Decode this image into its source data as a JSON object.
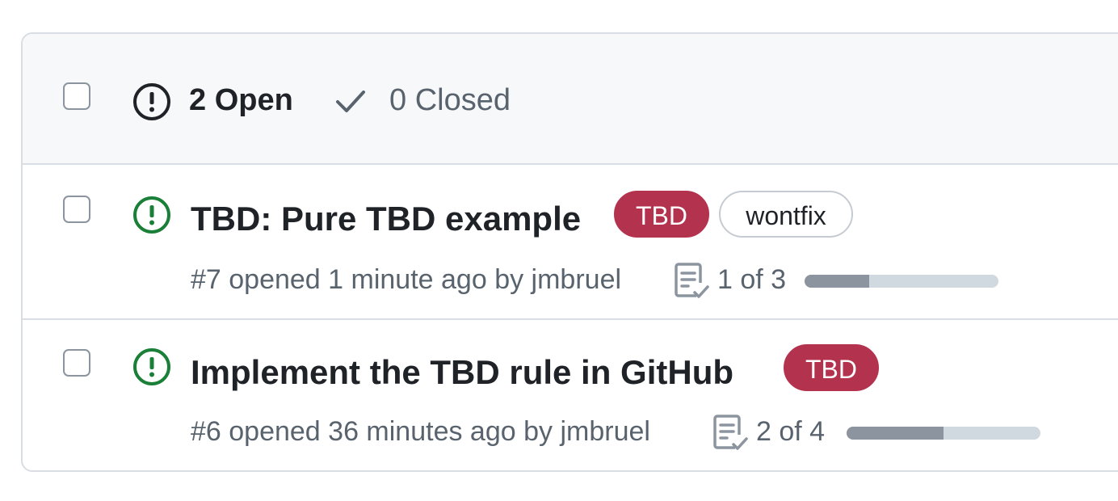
{
  "header": {
    "open_label": "2 Open",
    "closed_label": "0 Closed"
  },
  "issues": [
    {
      "title": "TBD: Pure TBD example",
      "labels": [
        {
          "name": "TBD",
          "bg": "#b3334f",
          "fg": "#ffffff",
          "border": "#b3334f"
        },
        {
          "name": "wontfix",
          "bg": "#ffffff",
          "fg": "#1f2328",
          "border": "#c6cbd1"
        }
      ],
      "meta": "#7 opened 1 minute ago by jmbruel",
      "tasks": "1 of 3",
      "task_progress": 0.333
    },
    {
      "title": "Implement the TBD rule in GitHub",
      "labels": [
        {
          "name": "TBD",
          "bg": "#b3334f",
          "fg": "#ffffff",
          "border": "#b3334f"
        }
      ],
      "meta": "#6 opened 36 minutes ago by jmbruel",
      "tasks": "2 of 4",
      "task_progress": 0.5
    }
  ],
  "colors": {
    "open_icon": "#1a7f37",
    "header_bg": "#f6f8fa",
    "border": "#d8dee4"
  },
  "icons": [
    "issue-opened-icon",
    "check-icon",
    "checklist-icon"
  ]
}
